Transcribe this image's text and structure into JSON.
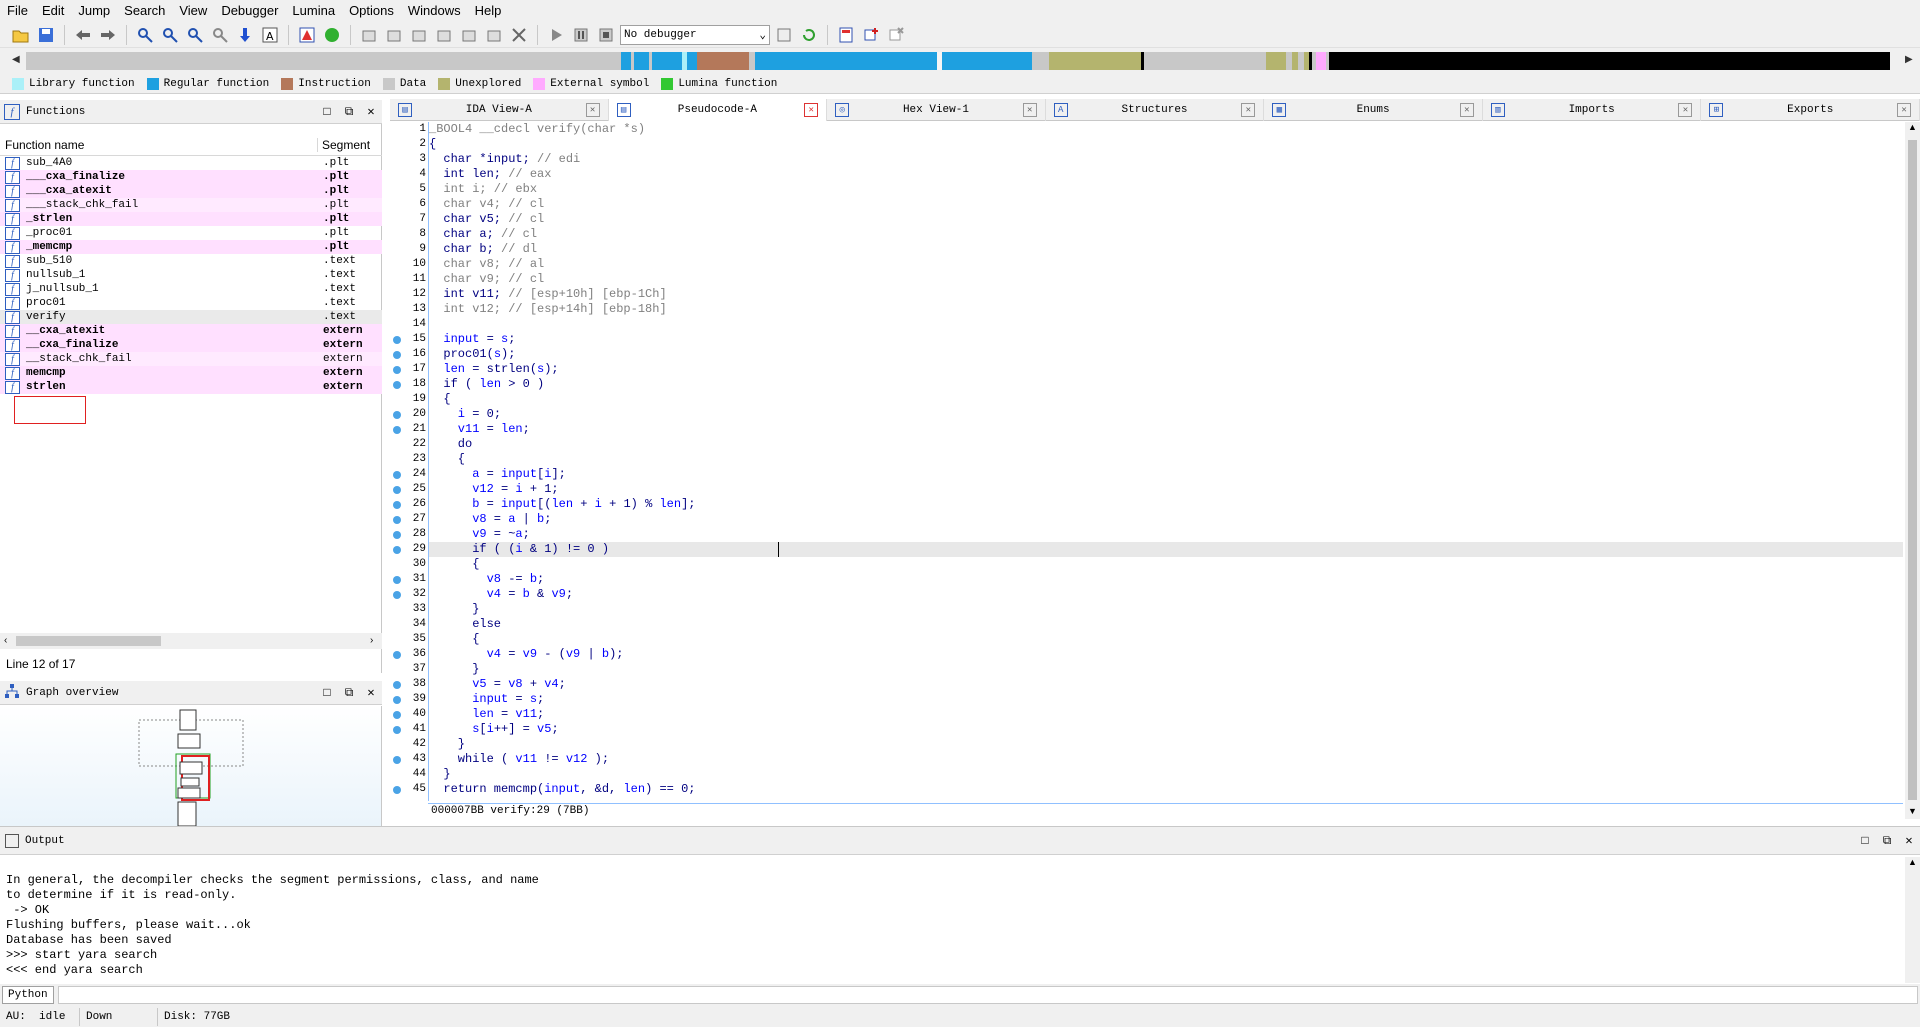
{
  "menu": [
    "File",
    "Edit",
    "Jump",
    "Search",
    "View",
    "Debugger",
    "Lumina",
    "Options",
    "Windows",
    "Help"
  ],
  "toolbar": {
    "debugger_select": "No debugger"
  },
  "legend": [
    {
      "label": "Library function",
      "color": "#aaf0f8"
    },
    {
      "label": "Regular function",
      "color": "#1ea0e0"
    },
    {
      "label": "Instruction",
      "color": "#b4785a"
    },
    {
      "label": "Data",
      "color": "#c8c8c8"
    },
    {
      "label": "Unexplored",
      "color": "#b4b46e"
    },
    {
      "label": "External symbol",
      "color": "#ffaaff"
    },
    {
      "label": "Lumina function",
      "color": "#32c832"
    }
  ],
  "functions_panel": {
    "title": "Functions",
    "col_name": "Function name",
    "col_segment": "Segment",
    "rows": [
      {
        "name": "sub_4A0",
        "segment": ".plt",
        "style": "normal"
      },
      {
        "name": "___cxa_finalize",
        "segment": ".plt",
        "style": "pink"
      },
      {
        "name": "___cxa_atexit",
        "segment": ".plt",
        "style": "pink"
      },
      {
        "name": "___stack_chk_fail",
        "segment": ".plt",
        "style": "pink-light"
      },
      {
        "name": "_strlen",
        "segment": ".plt",
        "style": "pink"
      },
      {
        "name": "_proc01",
        "segment": ".plt",
        "style": "normal"
      },
      {
        "name": "_memcmp",
        "segment": ".plt",
        "style": "pink"
      },
      {
        "name": "sub_510",
        "segment": ".text",
        "style": "normal"
      },
      {
        "name": "nullsub_1",
        "segment": ".text",
        "style": "normal"
      },
      {
        "name": "j_nullsub_1",
        "segment": ".text",
        "style": "normal"
      },
      {
        "name": "proc01",
        "segment": ".text",
        "style": "normal"
      },
      {
        "name": "verify",
        "segment": ".text",
        "style": "selected"
      },
      {
        "name": "__cxa_atexit",
        "segment": "extern",
        "style": "pink"
      },
      {
        "name": "__cxa_finalize",
        "segment": "extern",
        "style": "pink"
      },
      {
        "name": "__stack_chk_fail",
        "segment": "extern",
        "style": "pink-light"
      },
      {
        "name": "memcmp",
        "segment": "extern",
        "style": "pink"
      },
      {
        "name": "strlen",
        "segment": "extern",
        "style": "pink"
      }
    ],
    "status": "Line 12 of 17"
  },
  "graph_panel": {
    "title": "Graph overview"
  },
  "tabs": [
    {
      "label": "IDA View-A",
      "icon": "ida-view-icon",
      "active": false
    },
    {
      "label": "Pseudocode-A",
      "icon": "pseudocode-icon",
      "active": true
    },
    {
      "label": "Hex View-1",
      "icon": "hex-view-icon",
      "active": false
    },
    {
      "label": "Structures",
      "icon": "structures-icon",
      "active": false
    },
    {
      "label": "Enums",
      "icon": "enums-icon",
      "active": false
    },
    {
      "label": "Imports",
      "icon": "imports-icon",
      "active": false
    },
    {
      "label": "Exports",
      "icon": "exports-icon",
      "active": false
    }
  ],
  "code": {
    "current_line": 29,
    "lines": [
      {
        "n": "1",
        "dot": false,
        "segs": [
          [
            "gr",
            "_BOOL4 __cdecl verify(char *s)"
          ]
        ]
      },
      {
        "n": "2",
        "dot": false,
        "segs": [
          [
            "bl",
            "{"
          ]
        ]
      },
      {
        "n": "3",
        "dot": false,
        "segs": [
          [
            "bl",
            "  char *input; "
          ],
          [
            "gr",
            "// edi"
          ]
        ]
      },
      {
        "n": "4",
        "dot": false,
        "segs": [
          [
            "bl",
            "  int len; "
          ],
          [
            "gr",
            "// eax"
          ]
        ]
      },
      {
        "n": "5",
        "dot": false,
        "segs": [
          [
            "gr",
            "  int i; // ebx"
          ]
        ]
      },
      {
        "n": "6",
        "dot": false,
        "segs": [
          [
            "gr",
            "  char v4; // cl"
          ]
        ]
      },
      {
        "n": "7",
        "dot": false,
        "segs": [
          [
            "bl",
            "  char v5; "
          ],
          [
            "gr",
            "// cl"
          ]
        ]
      },
      {
        "n": "8",
        "dot": false,
        "segs": [
          [
            "bl",
            "  char a; "
          ],
          [
            "gr",
            "// cl"
          ]
        ]
      },
      {
        "n": "9",
        "dot": false,
        "segs": [
          [
            "bl",
            "  char b; "
          ],
          [
            "gr",
            "// dl"
          ]
        ]
      },
      {
        "n": "10",
        "dot": false,
        "segs": [
          [
            "gr",
            "  char v8; // al"
          ]
        ]
      },
      {
        "n": "11",
        "dot": false,
        "segs": [
          [
            "gr",
            "  char v9; // cl"
          ]
        ]
      },
      {
        "n": "12",
        "dot": false,
        "segs": [
          [
            "bl",
            "  int v11; "
          ],
          [
            "gr",
            "// [esp+10h] [ebp-1Ch]"
          ]
        ]
      },
      {
        "n": "13",
        "dot": false,
        "segs": [
          [
            "gr",
            "  int v12; // [esp+14h] [ebp-18h]"
          ]
        ]
      },
      {
        "n": "14",
        "dot": false,
        "segs": [
          [
            "bl",
            ""
          ]
        ]
      },
      {
        "n": "15",
        "dot": true,
        "segs": [
          [
            "vr",
            "  input"
          ],
          [
            "bl",
            " = "
          ],
          [
            "vr",
            "s"
          ],
          [
            "bl",
            ";"
          ]
        ]
      },
      {
        "n": "16",
        "dot": true,
        "segs": [
          [
            "bl",
            "  proc01("
          ],
          [
            "vr",
            "s"
          ],
          [
            "bl",
            ");"
          ]
        ]
      },
      {
        "n": "17",
        "dot": true,
        "segs": [
          [
            "vr",
            "  len"
          ],
          [
            "bl",
            " = strlen("
          ],
          [
            "vr",
            "s"
          ],
          [
            "bl",
            ");"
          ]
        ]
      },
      {
        "n": "18",
        "dot": true,
        "segs": [
          [
            "bl",
            "  if ( "
          ],
          [
            "vr",
            "len"
          ],
          [
            "bl",
            " > 0 )"
          ]
        ]
      },
      {
        "n": "19",
        "dot": false,
        "segs": [
          [
            "bl",
            "  {"
          ]
        ]
      },
      {
        "n": "20",
        "dot": true,
        "segs": [
          [
            "vr",
            "    i"
          ],
          [
            "bl",
            " = 0;"
          ]
        ]
      },
      {
        "n": "21",
        "dot": true,
        "segs": [
          [
            "vr",
            "    v11"
          ],
          [
            "bl",
            " = "
          ],
          [
            "vr",
            "len"
          ],
          [
            "bl",
            ";"
          ]
        ]
      },
      {
        "n": "22",
        "dot": false,
        "segs": [
          [
            "bl",
            "    do"
          ]
        ]
      },
      {
        "n": "23",
        "dot": false,
        "segs": [
          [
            "bl",
            "    {"
          ]
        ]
      },
      {
        "n": "24",
        "dot": true,
        "segs": [
          [
            "vr",
            "      a"
          ],
          [
            "bl",
            " = "
          ],
          [
            "vr",
            "input"
          ],
          [
            "bl",
            "["
          ],
          [
            "vr",
            "i"
          ],
          [
            "bl",
            "];"
          ]
        ]
      },
      {
        "n": "25",
        "dot": true,
        "segs": [
          [
            "vr",
            "      v12"
          ],
          [
            "bl",
            " = "
          ],
          [
            "vr",
            "i"
          ],
          [
            "bl",
            " + 1;"
          ]
        ]
      },
      {
        "n": "26",
        "dot": true,
        "segs": [
          [
            "vr",
            "      b"
          ],
          [
            "bl",
            " = "
          ],
          [
            "vr",
            "input"
          ],
          [
            "bl",
            "[("
          ],
          [
            "vr",
            "len"
          ],
          [
            "bl",
            " + "
          ],
          [
            "vr",
            "i"
          ],
          [
            "bl",
            " + 1) % "
          ],
          [
            "vr",
            "len"
          ],
          [
            "bl",
            "];"
          ]
        ]
      },
      {
        "n": "27",
        "dot": true,
        "segs": [
          [
            "vr",
            "      v8"
          ],
          [
            "bl",
            " = "
          ],
          [
            "vr",
            "a"
          ],
          [
            "bl",
            " | "
          ],
          [
            "vr",
            "b"
          ],
          [
            "bl",
            ";"
          ]
        ]
      },
      {
        "n": "28",
        "dot": true,
        "segs": [
          [
            "vr",
            "      v9"
          ],
          [
            "bl",
            " = ~"
          ],
          [
            "vr",
            "a"
          ],
          [
            "bl",
            ";"
          ]
        ]
      },
      {
        "n": "29",
        "dot": true,
        "segs": [
          [
            "bl",
            "      if ( ("
          ],
          [
            "vr",
            "i"
          ],
          [
            "bl",
            " & 1) != 0 )"
          ]
        ]
      },
      {
        "n": "30",
        "dot": false,
        "segs": [
          [
            "bl",
            "      {"
          ]
        ]
      },
      {
        "n": "31",
        "dot": true,
        "segs": [
          [
            "vr",
            "        v8"
          ],
          [
            "bl",
            " -= "
          ],
          [
            "vr",
            "b"
          ],
          [
            "bl",
            ";"
          ]
        ]
      },
      {
        "n": "32",
        "dot": true,
        "segs": [
          [
            "vr",
            "        v4"
          ],
          [
            "bl",
            " = "
          ],
          [
            "vr",
            "b"
          ],
          [
            "bl",
            " & "
          ],
          [
            "vr",
            "v9"
          ],
          [
            "bl",
            ";"
          ]
        ]
      },
      {
        "n": "33",
        "dot": false,
        "segs": [
          [
            "bl",
            "      }"
          ]
        ]
      },
      {
        "n": "34",
        "dot": false,
        "segs": [
          [
            "bl",
            "      else"
          ]
        ]
      },
      {
        "n": "35",
        "dot": false,
        "segs": [
          [
            "bl",
            "      {"
          ]
        ]
      },
      {
        "n": "36",
        "dot": true,
        "segs": [
          [
            "vr",
            "        v4"
          ],
          [
            "bl",
            " = "
          ],
          [
            "vr",
            "v9"
          ],
          [
            "bl",
            " - ("
          ],
          [
            "vr",
            "v9"
          ],
          [
            "bl",
            " | "
          ],
          [
            "vr",
            "b"
          ],
          [
            "bl",
            ");"
          ]
        ]
      },
      {
        "n": "37",
        "dot": false,
        "segs": [
          [
            "bl",
            "      }"
          ]
        ]
      },
      {
        "n": "38",
        "dot": true,
        "segs": [
          [
            "vr",
            "      v5"
          ],
          [
            "bl",
            " = "
          ],
          [
            "vr",
            "v8"
          ],
          [
            "bl",
            " + "
          ],
          [
            "vr",
            "v4"
          ],
          [
            "bl",
            ";"
          ]
        ]
      },
      {
        "n": "39",
        "dot": true,
        "segs": [
          [
            "vr",
            "      input"
          ],
          [
            "bl",
            " = "
          ],
          [
            "vr",
            "s"
          ],
          [
            "bl",
            ";"
          ]
        ]
      },
      {
        "n": "40",
        "dot": true,
        "segs": [
          [
            "vr",
            "      len"
          ],
          [
            "bl",
            " = "
          ],
          [
            "vr",
            "v11"
          ],
          [
            "bl",
            ";"
          ]
        ]
      },
      {
        "n": "41",
        "dot": true,
        "segs": [
          [
            "vr",
            "      s"
          ],
          [
            "bl",
            "["
          ],
          [
            "vr",
            "i"
          ],
          [
            "bl",
            "++] = "
          ],
          [
            "vr",
            "v5"
          ],
          [
            "bl",
            ";"
          ]
        ]
      },
      {
        "n": "42",
        "dot": false,
        "segs": [
          [
            "bl",
            "    }"
          ]
        ]
      },
      {
        "n": "43",
        "dot": true,
        "segs": [
          [
            "bl",
            "    while ( "
          ],
          [
            "vr",
            "v11"
          ],
          [
            "bl",
            " != "
          ],
          [
            "vr",
            "v12"
          ],
          [
            "bl",
            " );"
          ]
        ]
      },
      {
        "n": "44",
        "dot": false,
        "segs": [
          [
            "bl",
            "  }"
          ]
        ]
      },
      {
        "n": "45",
        "dot": true,
        "segs": [
          [
            "bl",
            "  return memcmp("
          ],
          [
            "vr",
            "input"
          ],
          [
            "bl",
            ", &d, "
          ],
          [
            "vr",
            "len"
          ],
          [
            "bl",
            ") == 0;"
          ]
        ]
      }
    ],
    "status": "000007BB verify:29 (7BB)"
  },
  "output_panel": {
    "title": "Output",
    "lines": [
      "In general, the decompiler checks the segment permissions, class, and name",
      "to determine if it is read-only.",
      " -> OK",
      "Flushing buffers, please wait...ok",
      "Database has been saved",
      ">>> start yara search",
      "<<< end yara search"
    ]
  },
  "python_bar": {
    "label": "Python"
  },
  "statusbar": {
    "au_label": "AU:",
    "au_state": "idle",
    "direction": "Down",
    "disk": "Disk: 77GB"
  }
}
